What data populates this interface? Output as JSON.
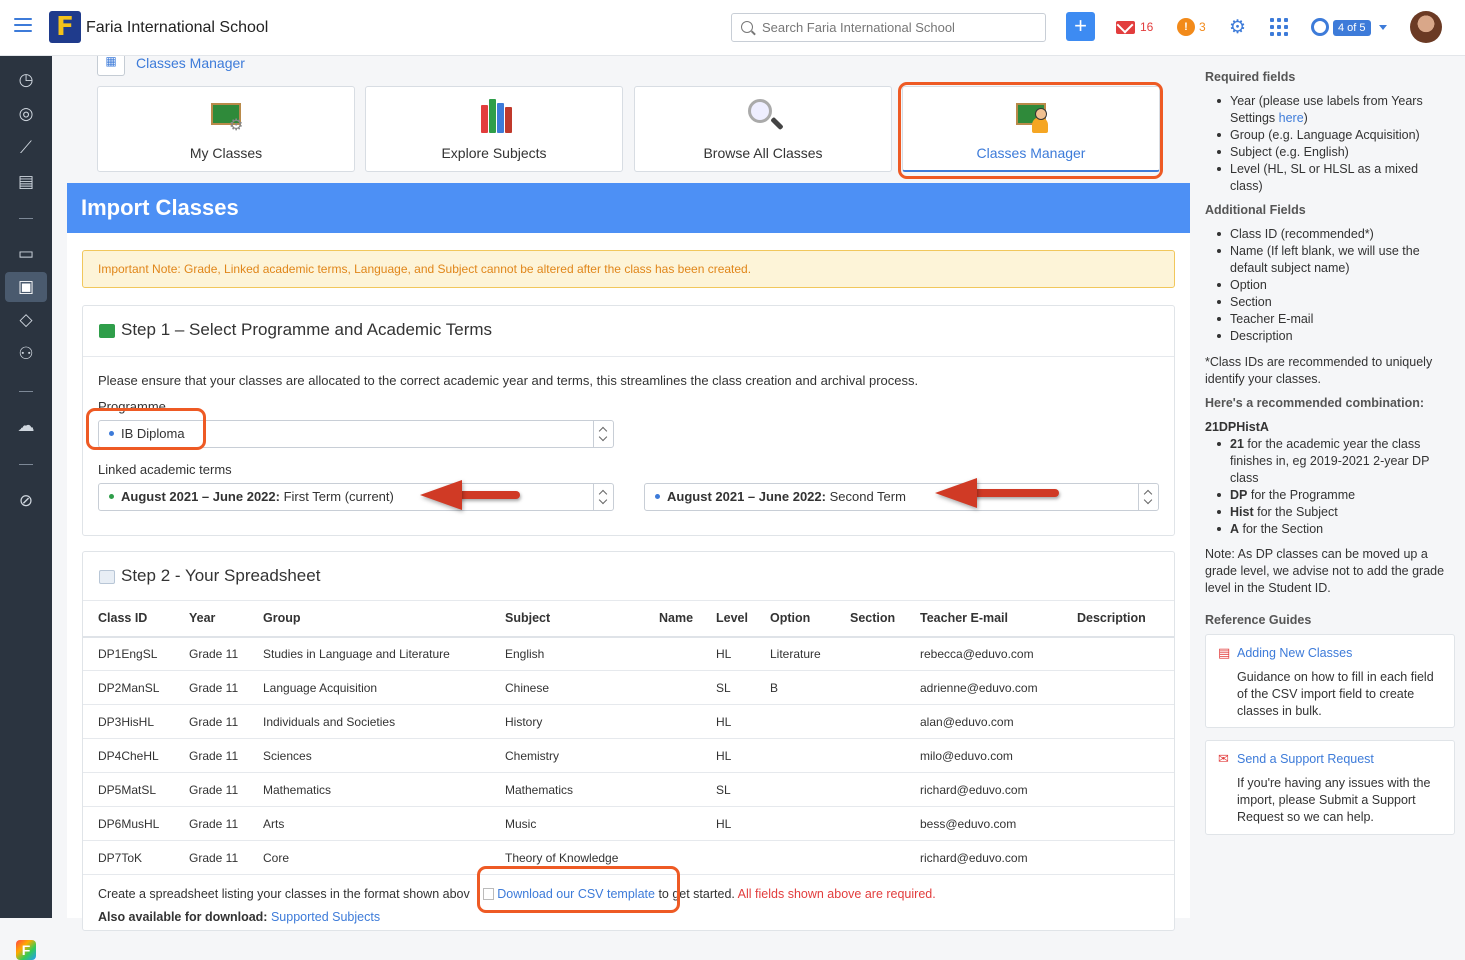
{
  "header": {
    "school_name": "Faria International School",
    "logo_letter": "F",
    "search_placeholder": "Search Faria International School",
    "add_label": "+",
    "mail_count": "16",
    "chat_count": "3",
    "help_badge": "4 of 5"
  },
  "breadcrumb": "Classes Manager",
  "tiles": [
    {
      "label": "My Classes",
      "icon": "chalkboard-gear-icon"
    },
    {
      "label": "Explore Subjects",
      "icon": "books-icon"
    },
    {
      "label": "Browse All Classes",
      "icon": "magnifier-icon"
    },
    {
      "label": "Classes Manager",
      "icon": "chalkboard-person-icon"
    }
  ],
  "import": {
    "title": "Import Classes",
    "note": "Important Note: Grade, Linked academic terms, Language, and Subject cannot be altered after the class has been created."
  },
  "step1": {
    "title": "Step 1 – Select Programme and Academic Terms",
    "intro": "Please ensure that your classes are allocated to the correct academic year and terms, this streamlines the class creation and archival process.",
    "programme_label": "Programme",
    "programme_value": "IB Diploma",
    "terms_label": "Linked academic terms",
    "term1_bold": "August 2021 – June 2022:",
    "term1_rest": " First Term (current)",
    "term2_bold": "August 2021 – June 2022:",
    "term2_rest": " Second Term"
  },
  "step2": {
    "title": "Step 2 - Your Spreadsheet",
    "columns": [
      "Class ID",
      "Year",
      "Group",
      "Subject",
      "Name",
      "Level",
      "Option",
      "Section",
      "Teacher E-mail",
      "Description"
    ],
    "rows": [
      [
        "DP1EngSL",
        "Grade 11",
        "Studies in Language and Literature",
        "English",
        "",
        "HL",
        "Literature",
        "",
        "rebecca@eduvo.com",
        ""
      ],
      [
        "DP2ManSL",
        "Grade 11",
        "Language Acquisition",
        "Chinese",
        "",
        "SL",
        "B",
        "",
        "adrienne@eduvo.com",
        ""
      ],
      [
        "DP3HisHL",
        "Grade 11",
        "Individuals and Societies",
        "History",
        "",
        "HL",
        "",
        "",
        "alan@eduvo.com",
        ""
      ],
      [
        "DP4CheHL",
        "Grade 11",
        "Sciences",
        "Chemistry",
        "",
        "HL",
        "",
        "",
        "milo@eduvo.com",
        ""
      ],
      [
        "DP5MatSL",
        "Grade 11",
        "Mathematics",
        "Mathematics",
        "",
        "SL",
        "",
        "",
        "richard@eduvo.com",
        ""
      ],
      [
        "DP6MusHL",
        "Grade 11",
        "Arts",
        "Music",
        "",
        "HL",
        "",
        "",
        "bess@eduvo.com",
        ""
      ],
      [
        "DP7ToK",
        "Grade 11",
        "Core",
        "Theory of Knowledge",
        "",
        "",
        "",
        "",
        "richard@eduvo.com",
        ""
      ]
    ],
    "footer_before": "Create a spreadsheet listing your classes in the format shown abov",
    "footer_link": "Download our CSV template",
    "footer_after": "to get started.",
    "footer_required": "All fields shown above are required.",
    "footer2_text": "Also available for download:",
    "footer2_link": "Supported Subjects"
  },
  "right": {
    "required_title": "Required fields",
    "required_items": [
      "Year (please use labels from Years Settings here)",
      "Group (e.g. Language Acquisition)",
      "Subject (e.g. English)",
      "Level (HL, SL or HLSL as a mixed class)"
    ],
    "additional_title": "Additional Fields",
    "additional_items": [
      "Class ID (recommended*)",
      "Name (If left blank, we will use the default subject name)",
      "Option",
      "Section",
      "Teacher E-mail",
      "Description"
    ],
    "class_id_note": "*Class IDs are recommended to uniquely identify your classes.",
    "combo_title": "Here's a recommended combination:",
    "combo_code": "21DPHistA",
    "combo_items": [
      {
        "b": "21",
        "t": " for the academic year the class finishes in, eg 2019-2021 2-year DP class"
      },
      {
        "b": "DP",
        "t": " for the Programme"
      },
      {
        "b": "Hist",
        "t": " for the Subject"
      },
      {
        "b": "A",
        "t": " for the Section"
      }
    ],
    "dp_note": "Note: As DP classes can be moved up a grade level, we advise not to add the grade level in the Student ID.",
    "guides_title": "Reference Guides",
    "guide1_title": "Adding New Classes",
    "guide1_desc": "Guidance on how to fill in each field of the CSV import field to create classes in bulk.",
    "guide2_title": "Send a Support Request",
    "guide2_desc": "If you're having any issues with the import, please Submit a Support Request so we can help."
  },
  "colors": {
    "accent": "#3d7bd9",
    "header_bar": "#4d90f5",
    "highlight": "#ee5a24",
    "arrow": "#d03a25"
  }
}
